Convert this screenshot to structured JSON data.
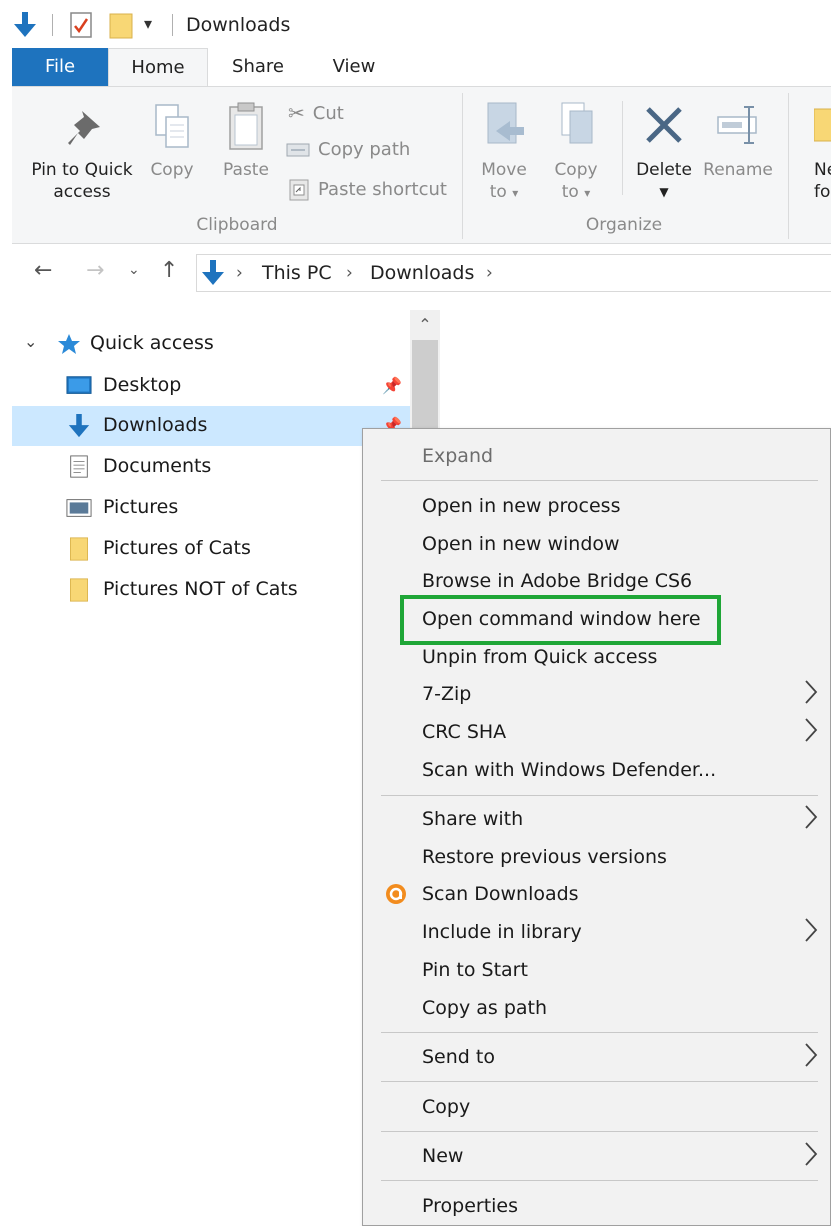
{
  "titlebar": {
    "title": "Downloads"
  },
  "tabs": {
    "file": "File",
    "home": "Home",
    "share": "Share",
    "view": "View"
  },
  "ribbon": {
    "clipboard": {
      "pin_line1": "Pin to Quick",
      "pin_line2": "access",
      "copy": "Copy",
      "paste": "Paste",
      "cut": "Cut",
      "copy_path": "Copy path",
      "paste_shortcut": "Paste shortcut",
      "group": "Clipboard"
    },
    "organize": {
      "move_line1": "Move",
      "move_line2": "to",
      "copy_line1": "Copy",
      "copy_line2": "to",
      "delete": "Delete",
      "rename": "Rename",
      "group": "Organize"
    },
    "new": {
      "line1": "Ne",
      "line2": "fol"
    }
  },
  "address": {
    "crumb1": "This PC",
    "crumb2": "Downloads"
  },
  "navpane": {
    "quick_access": "Quick access",
    "items": [
      "Desktop",
      "Downloads",
      "Documents",
      "Pictures",
      "Pictures of Cats",
      "Pictures NOT of Cats"
    ]
  },
  "menu": {
    "expand": "Expand",
    "open_new_process": "Open in new process",
    "open_new_window": "Open in new window",
    "browse_bridge": "Browse in Adobe Bridge CS6",
    "open_command": "Open command window here",
    "unpin": "Unpin from Quick access",
    "seven_zip": "7-Zip",
    "crc_sha": "CRC SHA",
    "scan_defender": "Scan with Windows Defender...",
    "share_with": "Share with",
    "restore_versions": "Restore previous versions",
    "scan_downloads": "Scan Downloads",
    "include_library": "Include in library",
    "pin_start": "Pin to Start",
    "copy_as_path": "Copy as path",
    "send_to": "Send to",
    "copy": "Copy",
    "new": "New",
    "properties": "Properties"
  },
  "colors": {
    "accent": "#1e73be",
    "selection": "#cce8ff",
    "highlight_box": "#1fa637",
    "menu_bg": "#f2f2f2"
  }
}
